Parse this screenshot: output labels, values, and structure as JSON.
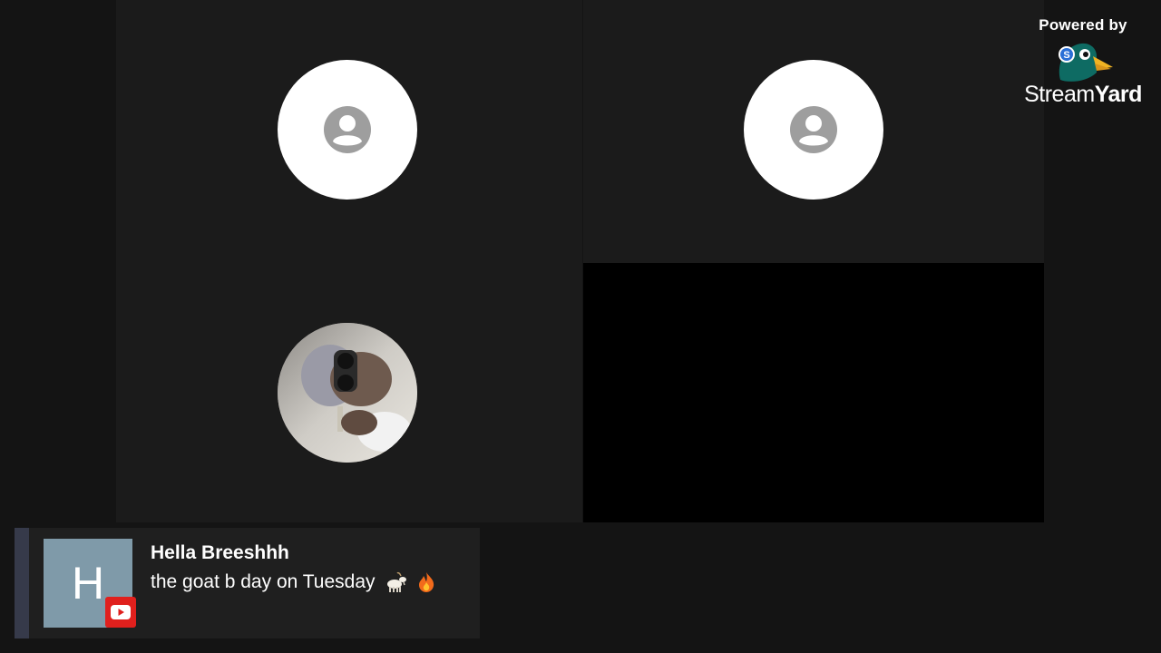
{
  "branding": {
    "powered_by": "Powered by",
    "brand_first": "Stream",
    "brand_second": "Yard",
    "logo_icon": "duck-logo-icon"
  },
  "participants": [
    {
      "type": "placeholder",
      "icon": "user-placeholder-icon"
    },
    {
      "type": "placeholder",
      "icon": "user-placeholder-icon"
    },
    {
      "type": "photo",
      "icon": "participant-photo"
    },
    {
      "type": "video-off",
      "icon": ""
    }
  ],
  "chat": {
    "avatar_letter": "H",
    "source_icon": "youtube-icon",
    "author": "Hella Breeshhh",
    "message": "the goat b day on Tuesday",
    "emojis": [
      "goat-emoji",
      "fire-emoji"
    ]
  },
  "colors": {
    "background": "#141414",
    "tile": "#1b1b1b",
    "accent": "#363a4a",
    "avatar_bg": "#7f9aa9",
    "youtube_red": "#e0201d"
  }
}
